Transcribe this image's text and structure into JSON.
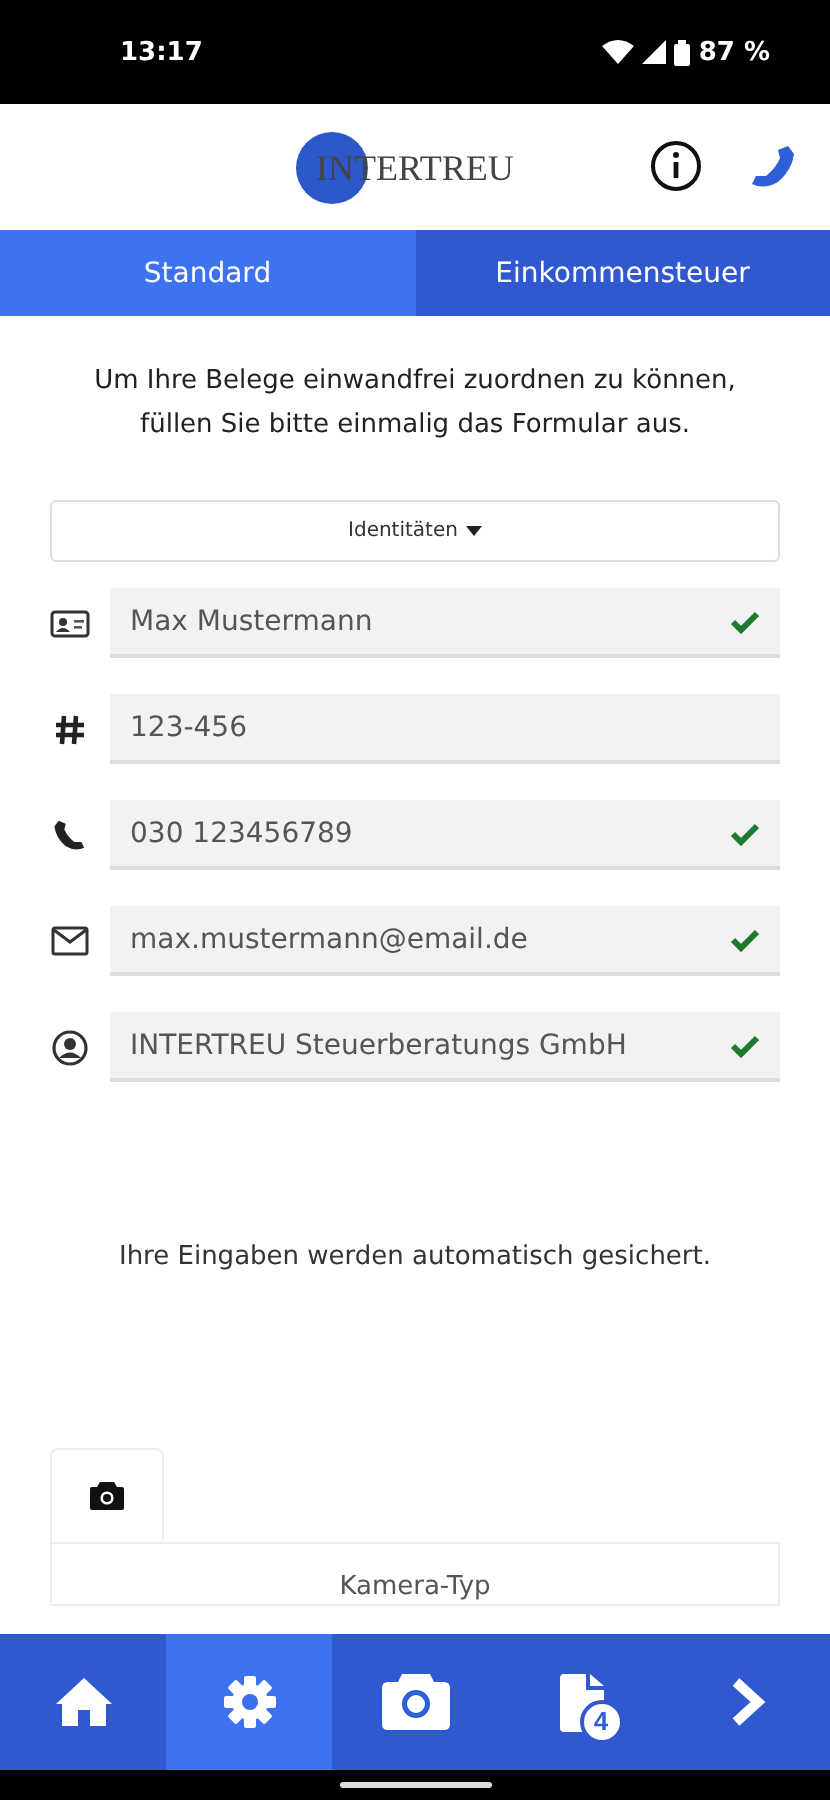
{
  "status_bar": {
    "time": "13:17",
    "battery": "87 %"
  },
  "header": {
    "logo": "INTERTREU"
  },
  "tabs": [
    {
      "label": "Standard",
      "selected": true
    },
    {
      "label": "Einkommensteuer",
      "selected": false
    }
  ],
  "intro": "Um Ihre Belege einwandfrei zuordnen zu können, füllen Sie bitte einmalig das Formular aus.",
  "dropdown": {
    "label": "Identitäten"
  },
  "fields": [
    {
      "kind": "name",
      "value": "Max Mustermann",
      "valid": true
    },
    {
      "kind": "number",
      "value": "123-456",
      "valid": false
    },
    {
      "kind": "phone",
      "value": "030 123456789",
      "valid": true
    },
    {
      "kind": "email",
      "value": "max.mustermann@email.de",
      "valid": true
    },
    {
      "kind": "company",
      "value": "INTERTREU Steuerberatungs GmbH",
      "valid": true
    }
  ],
  "autosave_note": "Ihre Eingaben werden automatisch gesichert.",
  "camera_panel": {
    "title": "Kamera-Typ"
  },
  "bottom_nav": [
    {
      "kind": "home",
      "selected": false
    },
    {
      "kind": "settings",
      "selected": true
    },
    {
      "kind": "camera",
      "selected": false
    },
    {
      "kind": "documents",
      "selected": false,
      "badge": "4"
    },
    {
      "kind": "next",
      "selected": false
    }
  ]
}
